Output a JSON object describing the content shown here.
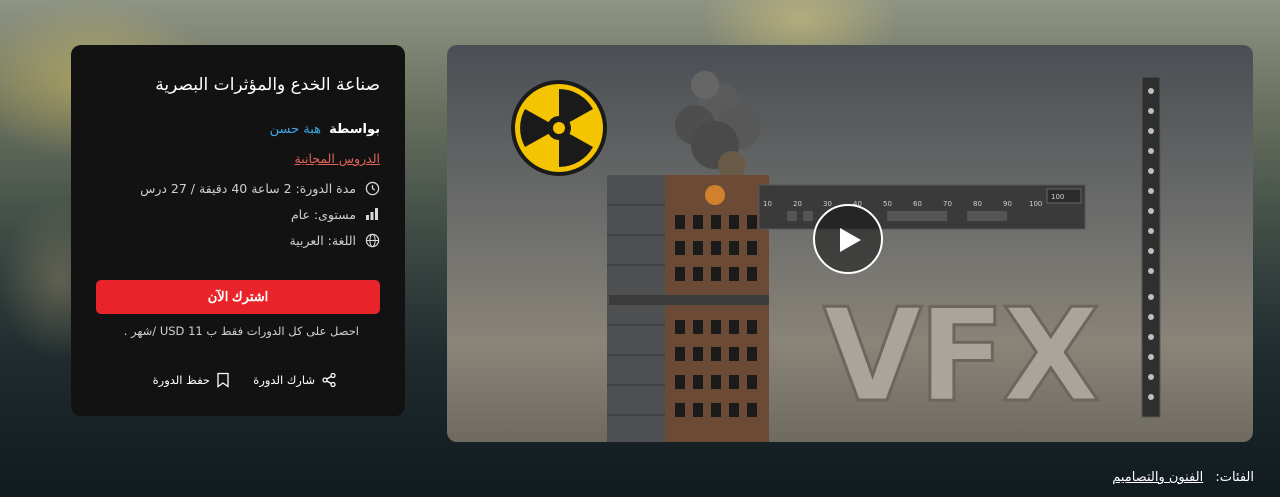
{
  "course": {
    "title": "صناعة الخدع والمؤثرات البصرية",
    "by_label": "بواسطة",
    "instructor": "هبة حسن",
    "free_lessons": "الدروس المجانية",
    "duration": "مدة الدورة: 2 ساعة 40 دقيقة / 27 درس",
    "level": "مستوى: عام",
    "language": "اللغة: العربية"
  },
  "cta": {
    "subscribe_label": "اشترك الآن",
    "note": "احصل على كل الدورات فقط ب 11 USD /شهر ."
  },
  "actions": {
    "share_label": "شارك الدورة",
    "save_label": "حفظ الدورة"
  },
  "video": {
    "overlay_text": "VFX",
    "timeline_numbers": [
      "10",
      "20",
      "30",
      "40",
      "50",
      "60",
      "70",
      "80",
      "90",
      "100"
    ],
    "frame_value": "100"
  },
  "categories": {
    "label": "الفئات:",
    "value": "الفنون والتصاميم"
  },
  "colors": {
    "accent_red": "#e8242a",
    "link_blue": "#3fa6e6",
    "free_link_red": "#e0645a",
    "card_bg": "#121212"
  }
}
